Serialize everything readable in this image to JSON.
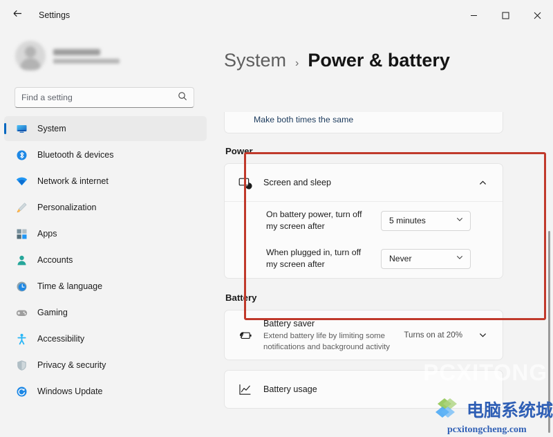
{
  "window": {
    "app_title": "Settings",
    "back_icon": "back-arrow-icon",
    "minimize_label": "Minimize",
    "maximize_label": "Maximize",
    "close_label": "Close"
  },
  "sidebar": {
    "profile": {
      "name": "",
      "subtitle": ""
    },
    "search": {
      "placeholder": "Find a setting",
      "value": "",
      "icon": "search-icon"
    },
    "items": [
      {
        "label": "System",
        "icon": "monitor-icon",
        "selected": true
      },
      {
        "label": "Bluetooth & devices",
        "icon": "bluetooth-icon",
        "selected": false
      },
      {
        "label": "Network & internet",
        "icon": "wifi-icon",
        "selected": false
      },
      {
        "label": "Personalization",
        "icon": "paintbrush-icon",
        "selected": false
      },
      {
        "label": "Apps",
        "icon": "apps-grid-icon",
        "selected": false
      },
      {
        "label": "Accounts",
        "icon": "person-icon",
        "selected": false
      },
      {
        "label": "Time & language",
        "icon": "clock-globe-icon",
        "selected": false
      },
      {
        "label": "Gaming",
        "icon": "gamepad-icon",
        "selected": false
      },
      {
        "label": "Accessibility",
        "icon": "accessibility-person-icon",
        "selected": false
      },
      {
        "label": "Privacy & security",
        "icon": "shield-icon",
        "selected": false
      },
      {
        "label": "Windows Update",
        "icon": "update-refresh-icon",
        "selected": false
      }
    ]
  },
  "breadcrumb": {
    "parent": "System",
    "separator": "›",
    "current": "Power & battery"
  },
  "main": {
    "top_card": {
      "link_label": "Make both times the same"
    },
    "power": {
      "section_title": "Power",
      "screen_and_sleep": {
        "title": "Screen and sleep",
        "icon": "monitor-moon-icon",
        "expander_icon": "chevron-up-icon",
        "expanded": true,
        "settings": [
          {
            "label": "On battery power, turn off my screen after",
            "value": "5 minutes",
            "chevron": "chevron-down-icon"
          },
          {
            "label": "When plugged in, turn off my screen after",
            "value": "Never",
            "chevron": "chevron-down-icon"
          }
        ]
      }
    },
    "battery": {
      "section_title": "Battery",
      "saver": {
        "title": "Battery saver",
        "description": "Extend battery life by limiting some notifications and background activity",
        "icon": "battery-leaf-icon",
        "value": "Turns on at 20%",
        "expander_icon": "chevron-down-icon"
      },
      "usage": {
        "title": "Battery usage",
        "icon": "line-chart-icon"
      }
    }
  },
  "watermark": {
    "ghost_text": "PCXITONG",
    "cn_text": "电脑系统城",
    "url_text": "pcxitongcheng.com",
    "logo_icon": "diamond-logo-icon"
  },
  "colors": {
    "accent": "#0067c0",
    "highlight_box": "#c0392b",
    "link": "#1b3a5c",
    "watermark": "#2f5fb5"
  }
}
